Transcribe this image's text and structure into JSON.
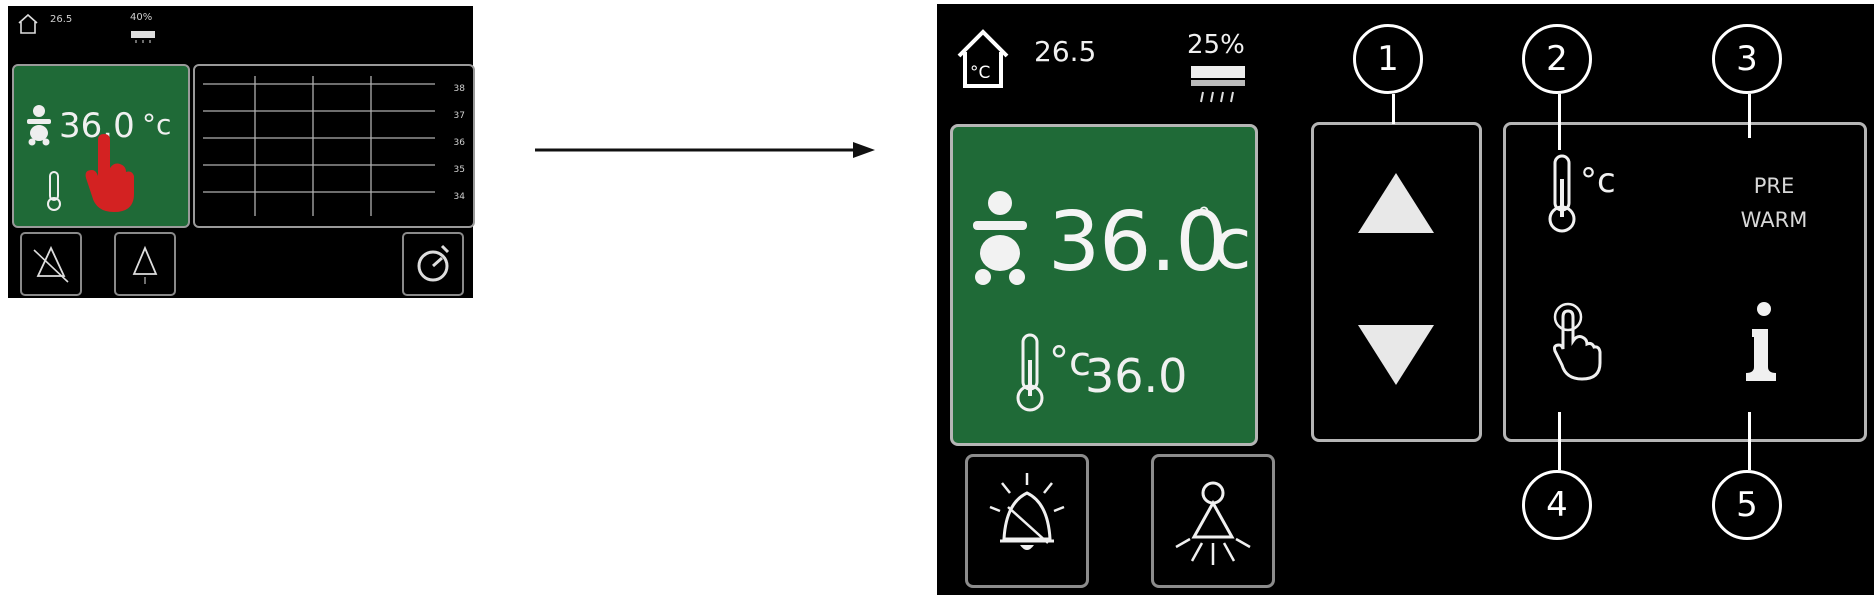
{
  "small_screen": {
    "home_temp": "26.5",
    "humidity": "40%",
    "baby_temperature": "36.0",
    "unit": "°c",
    "graph_ticks": [
      "38",
      "37",
      "36",
      "35",
      "34"
    ]
  },
  "large_screen": {
    "home_temp": "26.5",
    "humidity": "25%",
    "baby_temperature": "36.0",
    "unit_degree": "°",
    "unit_letter": "c",
    "skin_unit": "°c",
    "skin_temperature": "36.0",
    "temp_option_unit": "°c",
    "prewarm_label_line1": "PRE",
    "prewarm_label_line2": "WARM"
  },
  "callouts": [
    "1",
    "2",
    "3",
    "4",
    "5"
  ],
  "icons": {
    "home": "home-thermometer-icon",
    "humidity": "humidifier-icon",
    "baby": "baby-icon",
    "thermometer": "thermometer-icon",
    "up": "arrow-up-icon",
    "down": "arrow-down-icon",
    "touch": "touch-hand-icon",
    "info": "info-icon",
    "alarm": "alarm-bell-icon",
    "light": "light-bulb-icon",
    "timer": "timer-icon"
  },
  "colors": {
    "panel_green": "#1f6a37",
    "touch_indicator": "#d32222",
    "screen_background": "#000000"
  }
}
